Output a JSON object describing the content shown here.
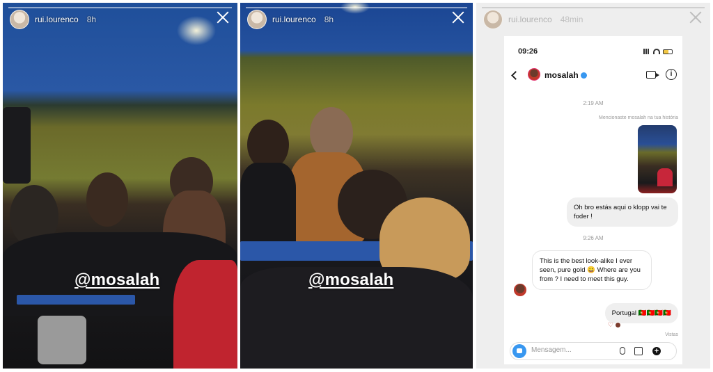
{
  "stories": [
    {
      "username": "rui.lourenco",
      "time": "8h",
      "mention": "@mosalah"
    },
    {
      "username": "rui.lourenco",
      "time": "8h",
      "mention": "@mosalah"
    }
  ],
  "dm_story": {
    "username": "rui.lourenco",
    "time": "48min",
    "status_time": "09:26",
    "chat": {
      "contact": "mosalah",
      "timestamp1": "2:19 AM",
      "mention_note": "Mencionaste mosalah na tua história",
      "msg_out_1": "Oh bro estás aqui o klopp vai te foder !",
      "timestamp2": "9:26 AM",
      "msg_in_1": "This is the best look-alike I ever seen, pure gold 😀 Where are you from ? I need to meet this guy.",
      "msg_out_2": "Portugal 🇵🇹🇵🇹🇵🇹🇵🇹",
      "seen": "Vistas",
      "composer_placeholder": "Mensagem...",
      "info_glyph": "i",
      "plus_glyph": "+"
    }
  }
}
